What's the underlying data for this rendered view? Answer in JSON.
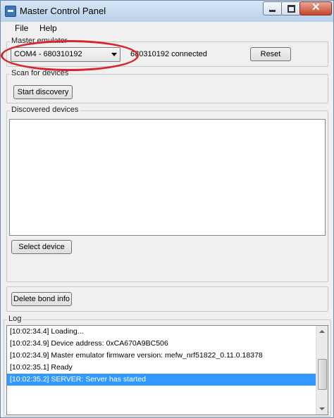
{
  "window": {
    "title": "Master Control Panel"
  },
  "menu": [
    {
      "label": "File"
    },
    {
      "label": "Help"
    }
  ],
  "master_emulator": {
    "legend": "Master emulator",
    "selected_port": "COM4 - 680310192",
    "status": "680310192 connected",
    "reset_label": "Reset"
  },
  "scan": {
    "legend": "Scan for devices",
    "start_label": "Start discovery"
  },
  "discovered": {
    "legend": "Discovered devices",
    "items": [],
    "select_label": "Select device"
  },
  "bond": {
    "delete_label": "Delete bond info"
  },
  "log": {
    "legend": "Log",
    "lines": [
      "[10:02:34.4] Loading...",
      "[10:02:34.9] Device address: 0xCA670A9BC506",
      "[10:02:34.9] Master emulator firmware version: mefw_nrf51822_0.11.0.18378",
      "[10:02:35.1] Ready",
      "[10:02:35.2] SERVER: Server has started"
    ],
    "selected_index": 4
  },
  "colors": {
    "annotation": "#d8262f",
    "selection": "#3399ff"
  }
}
